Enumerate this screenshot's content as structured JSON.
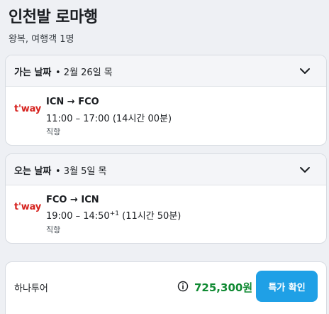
{
  "header": {
    "title": "인천발 로마행",
    "subtitle": "왕복, 여행객 1명"
  },
  "outbound": {
    "label": "가는 날짜",
    "date": "• 2월 26일 목",
    "airline_logo": "t'way",
    "route": "ICN → FCO",
    "time": "11:00 – 17:00 (14시간 00분)",
    "stops": "직항",
    "expand_icon": "chevron-down-icon"
  },
  "return": {
    "label": "오는 날짜",
    "date": "• 3월 5일 목",
    "airline_logo": "t'way",
    "route": "FCO → ICN",
    "time_depart_arrive": "19:00 – 14:50",
    "day_offset": "+1",
    "duration": "(11시간 50분)",
    "stops": "직항",
    "expand_icon": "chevron-down-icon"
  },
  "deal": {
    "provider": "하나투어",
    "info_icon": "info-icon",
    "price": "725,300원",
    "cta_label": "특가 확인"
  },
  "colors": {
    "background": "#eef0f4",
    "card": "#ffffff",
    "price": "#108a33",
    "button": "#1fa0e6",
    "airline_brand": "#d6221e"
  }
}
